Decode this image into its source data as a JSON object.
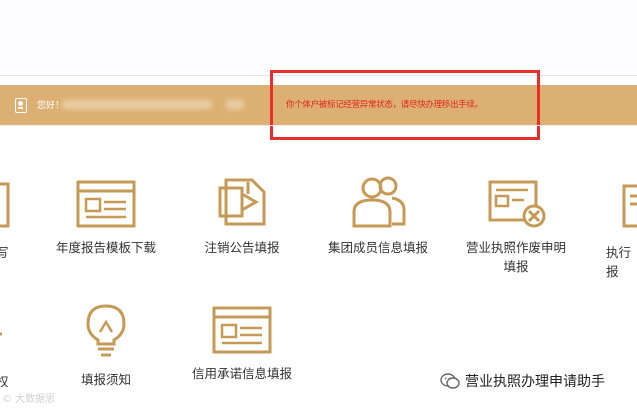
{
  "notice_bar": {
    "greeting": "您好！",
    "alert_text": "你个体户被标记经营异常状态，请尽快办理移出手续。"
  },
  "tiles_row1": [
    {
      "label": "年度报告模板下载",
      "icon": "web-template-icon"
    },
    {
      "label": "注销公告填报",
      "icon": "document-fold-icon"
    },
    {
      "label": "集团成员信息填报",
      "icon": "group-users-icon"
    },
    {
      "label": "营业执照作废申明填报",
      "icon": "certificate-cancel-icon"
    }
  ],
  "tiles_row2": [
    {
      "label": "填报须知",
      "icon": "lightbulb-icon"
    },
    {
      "label": "信用承诺信息填报",
      "icon": "web-template-icon"
    }
  ],
  "partial": {
    "left_row1": "写",
    "left_row2": "权",
    "right_row1_a": "执行",
    "right_row1_b": "报"
  },
  "watermarks": {
    "left": "© 大数据思",
    "right": "营业执照办理申请助手"
  },
  "colors": {
    "gold_bar": "#dcb072",
    "icon_gold": "#c49a56",
    "alert_red": "#e0261d"
  }
}
